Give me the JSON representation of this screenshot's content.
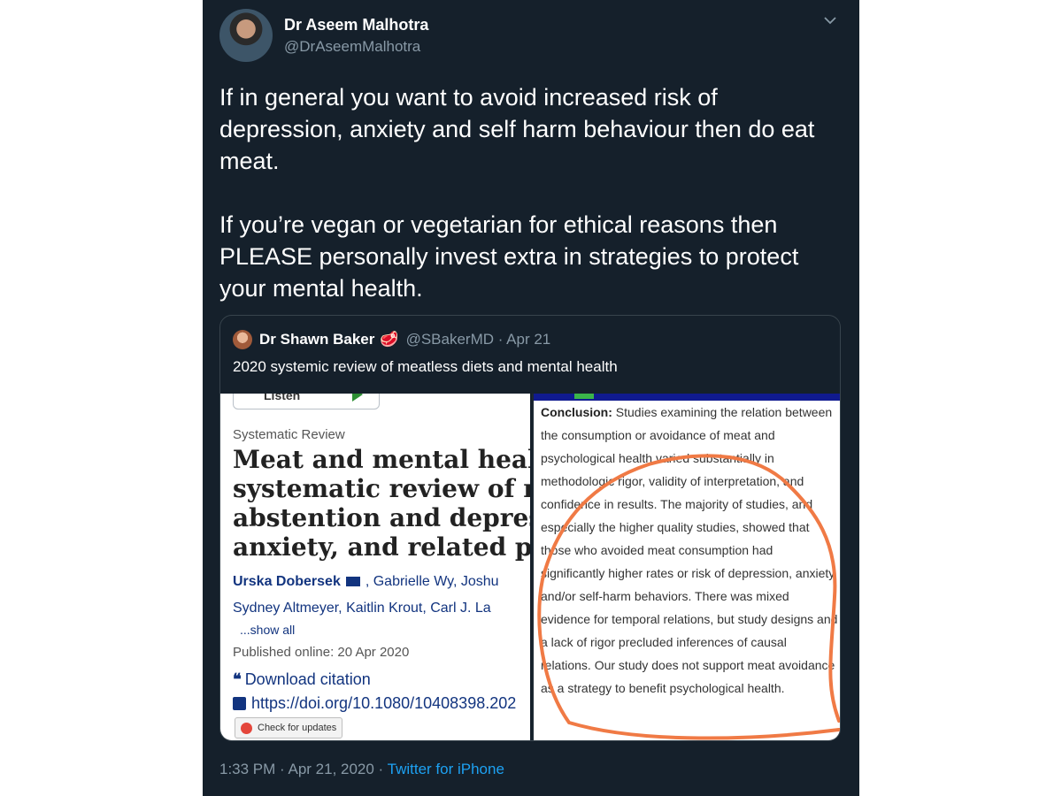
{
  "tweet": {
    "author_name": "Dr Aseem Malhotra",
    "author_handle": "@DrAseemMalhotra",
    "text": "If in general you want to avoid increased risk of depression, anxiety and self harm behaviour then do eat  meat.\n\nIf you’re vegan or vegetarian for ethical reasons then PLEASE personally invest extra in strategies to protect your mental health.",
    "time": "1:33 PM · Apr 21, 2020 · ",
    "source": "Twitter for iPhone"
  },
  "quote": {
    "author_name": "Dr Shawn Baker",
    "emoji": "🥩",
    "meta": "@SBakerMD · Apr 21",
    "text": "2020 systemic review of meatless diets and mental health",
    "left_image": {
      "listen": "Listen",
      "label": "Systematic Review",
      "title": "Meat and mental health: a systematic review of meat abstention and depression, anxiety, and related phenomena",
      "title_lines": [
        "Meat and mental health",
        "systematic review of me",
        "abstention and depress",
        "anxiety, and related phe"
      ],
      "authors_line1_a": "Urska Dobersek",
      "authors_line1_b": ", Gabrielle Wy,  Joshu",
      "authors_line2": "Sydney Altmeyer,  Kaitlin Krout,  Carl J. La",
      "show_all": "...show all",
      "published": "Published online: 20 Apr 2020",
      "download": "Download citation",
      "doi": "https://doi.org/10.1080/10408398.202",
      "check_updates": "Check for updates"
    },
    "right_image": {
      "conclusion_label": "Conclusion:",
      "conclusion_text": " Studies examining the relation between the consumption or avoidance of meat and psychological health varied substantially in methodologic rigor, validity of interpretation, and confidence in results. The majority of studies, and especially the higher quality studies, showed that those who avoided meat consumption had significantly higher rates or risk of depression, anxiety, and/or self-harm behaviors. There was mixed evidence for temporal relations, but study designs and a lack of rigor precluded inferences of causal relations. Our study does not support meat avoidance as a strategy to benefit psychological health."
    }
  },
  "colors": {
    "background": "#15202b",
    "text": "#ffffff",
    "muted": "#8899a6",
    "link": "#1da1f2",
    "annotation": "#f07a45"
  }
}
